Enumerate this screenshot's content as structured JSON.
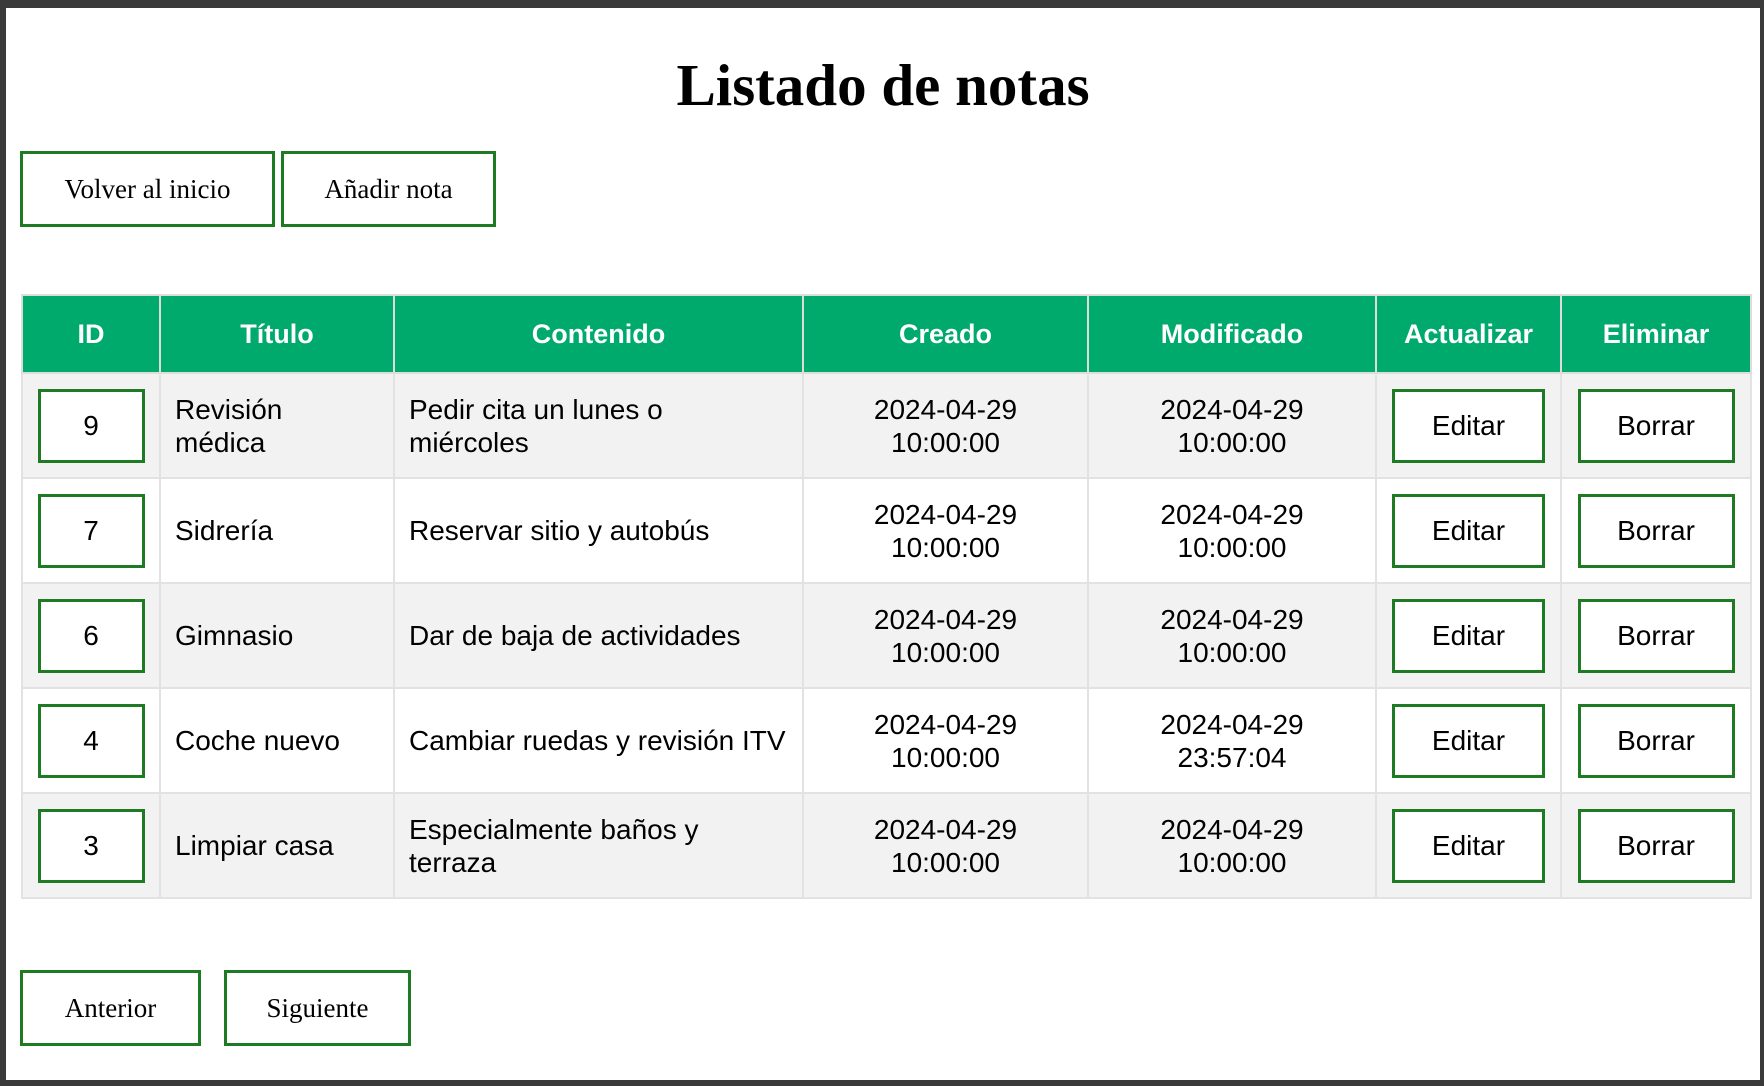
{
  "page": {
    "title": "Listado de notas"
  },
  "actions": {
    "home_label": "Volver al inicio",
    "add_label": "Añadir nota"
  },
  "table": {
    "headers": {
      "id": "ID",
      "title": "Título",
      "content": "Contenido",
      "created": "Creado",
      "modified": "Modificado",
      "update": "Actualizar",
      "delete": "Eliminar"
    },
    "rows": [
      {
        "id": "9",
        "title": "Revisión médica",
        "content": "Pedir cita un lunes o miércoles",
        "created_date": "2024-04-29",
        "created_time": "10:00:00",
        "modified_date": "2024-04-29",
        "modified_time": "10:00:00",
        "edit_label": "Editar",
        "delete_label": "Borrar"
      },
      {
        "id": "7",
        "title": "Sidrería",
        "content": "Reservar sitio y autobús",
        "created_date": "2024-04-29",
        "created_time": "10:00:00",
        "modified_date": "2024-04-29",
        "modified_time": "10:00:00",
        "edit_label": "Editar",
        "delete_label": "Borrar"
      },
      {
        "id": "6",
        "title": "Gimnasio",
        "content": "Dar de baja de actividades",
        "created_date": "2024-04-29",
        "created_time": "10:00:00",
        "modified_date": "2024-04-29",
        "modified_time": "10:00:00",
        "edit_label": "Editar",
        "delete_label": "Borrar"
      },
      {
        "id": "4",
        "title": "Coche nuevo",
        "content": "Cambiar ruedas y revisión ITV",
        "created_date": "2024-04-29",
        "created_time": "10:00:00",
        "modified_date": "2024-04-29",
        "modified_time": "23:57:04",
        "edit_label": "Editar",
        "delete_label": "Borrar"
      },
      {
        "id": "3",
        "title": "Limpiar casa",
        "content": "Especialmente baños y terraza",
        "created_date": "2024-04-29",
        "created_time": "10:00:00",
        "modified_date": "2024-04-29",
        "modified_time": "10:00:00",
        "edit_label": "Editar",
        "delete_label": "Borrar"
      }
    ]
  },
  "pagination": {
    "prev_label": "Anterior",
    "next_label": "Siguiente"
  },
  "colors": {
    "header_bg": "#00aa6c",
    "button_border": "#1f7a24",
    "row_alt": "#f2f2f2"
  }
}
